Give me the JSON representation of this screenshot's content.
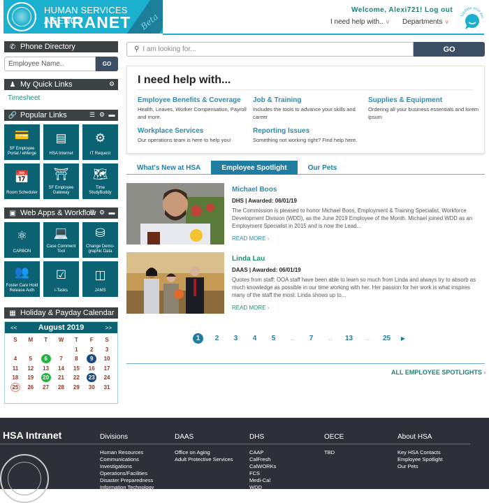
{
  "header": {
    "logo_line1": "HUMAN SERVICES AGENCY",
    "logo_line2": "INTRANET",
    "logo_badge": "Beta",
    "welcome": "Welcome, Alexi721!",
    "logout": "Log out",
    "nav": [
      {
        "label": "I need help with..",
        "icon": "chevron-down"
      },
      {
        "label": "Departments",
        "icon": "chevron-down"
      }
    ],
    "avatar_caption": "Update your picture"
  },
  "sidebar": {
    "phone_directory": {
      "title": "Phone Directory",
      "placeholder": "Employee Name..",
      "go": "GO"
    },
    "quick_links": {
      "title": "My Quick Links",
      "items": [
        "Timesheet"
      ]
    },
    "popular_links": {
      "title": "Popular Links",
      "tiles": [
        {
          "label": "SF Employee Portal / eMerge",
          "icon": "portal-icon"
        },
        {
          "label": "HSA Internet",
          "icon": "browser-icon"
        },
        {
          "label": "IT Request",
          "icon": "gear-hand-icon"
        },
        {
          "label": "Room Scheduler",
          "icon": "calendar-clock-icon"
        },
        {
          "label": "SF Employee Gateway",
          "icon": "gate-icon"
        },
        {
          "label": "Time StudyBuddy",
          "icon": "map-clock-icon"
        }
      ]
    },
    "web_apps": {
      "title": "Web Apps & Workflow",
      "tiles": [
        {
          "label": "CARBON",
          "icon": "molecule-icon"
        },
        {
          "label": "Case Comment Tool",
          "icon": "laptop-icon"
        },
        {
          "label": "Change Demo-graphic Data",
          "icon": "database-icon"
        },
        {
          "label": "Foster Care Hold Release Auth",
          "icon": "users-icon"
        },
        {
          "label": "i-Tasks",
          "icon": "checklist-icon"
        },
        {
          "label": "JAMS",
          "icon": "jar-icon"
        }
      ]
    },
    "calendar": {
      "title": "Holiday & Payday Calendar",
      "month": "August 2019",
      "prev": "<<",
      "next": ">>",
      "weekdays": [
        "S",
        "M",
        "T",
        "W",
        "T",
        "F",
        "S"
      ],
      "leading_blanks": 4,
      "days": 31,
      "holidays": [
        6,
        20
      ],
      "paydays": [
        9,
        23
      ],
      "today": 25
    }
  },
  "main": {
    "search": {
      "placeholder": "I am looking for...",
      "go": "GO"
    },
    "help": {
      "title": "I need help with...",
      "items": [
        {
          "title": "Employee Benefits & Coverage",
          "desc": "Health, Leaves, Worker Compensation, Payroll and more."
        },
        {
          "title": "Job & Training",
          "desc": "Includes the tools to advance your skills and career"
        },
        {
          "title": "Supplies & Equipment",
          "desc": "Ordering all your business essentials and lorem ipsum"
        },
        {
          "title": "Workplace Services",
          "desc": "Our operations team is here to help you!"
        },
        {
          "title": "Reporting Issues",
          "desc": "Something not working right? Find help here."
        }
      ]
    },
    "tabs": [
      {
        "label": "What's New at HSA",
        "active": false
      },
      {
        "label": "Employee Spotlight",
        "active": true
      },
      {
        "label": "Our Pets",
        "active": false
      }
    ],
    "posts": [
      {
        "name": "Michael Boos",
        "meta": "DHS | Awarded: 06/01/19",
        "body": "The Commission is pleased to honor Michael Boos, Employment & Training Specialist, Workforce Development Division (WDD), as the June 2019 Employee of the Month. Michael joined WDD as an Employment Specialist in 2015 and is now the Lead...",
        "more": "READ MORE"
      },
      {
        "name": "Linda Lau",
        "meta": "DAAS | Awarded: 06/01/19",
        "body": "Quotes from staff: OOA staff have been able to learn so much from Linda and always try to absorb as much knowledge as possible in our time working with her. Her passion for her work is what inspires many of the staff the most. Linda shows up to...",
        "more": "READ MORE"
      }
    ],
    "pagination": {
      "current": "1",
      "pages": [
        "1",
        "2",
        "3",
        "4",
        "5",
        "..",
        "7",
        "..",
        "13",
        "..",
        "25"
      ],
      "next": "▶"
    },
    "all_link": "ALL EMPLOYEE SPOTLIGHTS"
  },
  "footer": {
    "brand": "HSA Intranet",
    "columns": [
      {
        "title": "Divisions",
        "links": [
          "Human Resources",
          "Communications",
          "Investigations",
          "Operations/Facilities",
          "Disaster Preparedness",
          "Information Technology"
        ]
      },
      {
        "title": "DAAS",
        "links": [
          "Office on Aging",
          "Adult Protective Services"
        ]
      },
      {
        "title": "DHS",
        "links": [
          "CAAP",
          "CalFresh",
          "CalWORKs",
          "FCS",
          "Medi-Cal",
          "WDD"
        ]
      },
      {
        "title": "OECE",
        "links": [
          "TBD"
        ]
      },
      {
        "title": "About HSA",
        "links": [
          "Key HSA Contacts",
          "Employee Spotlight",
          "Our Pets"
        ]
      }
    ]
  },
  "colors": {
    "brand": "#1bb0ce",
    "teal_dark": "#0b6272",
    "tab_active": "#1e7da0",
    "accent": "#e87d6a",
    "link": "#2a8cae",
    "footer": "#2e3039"
  }
}
